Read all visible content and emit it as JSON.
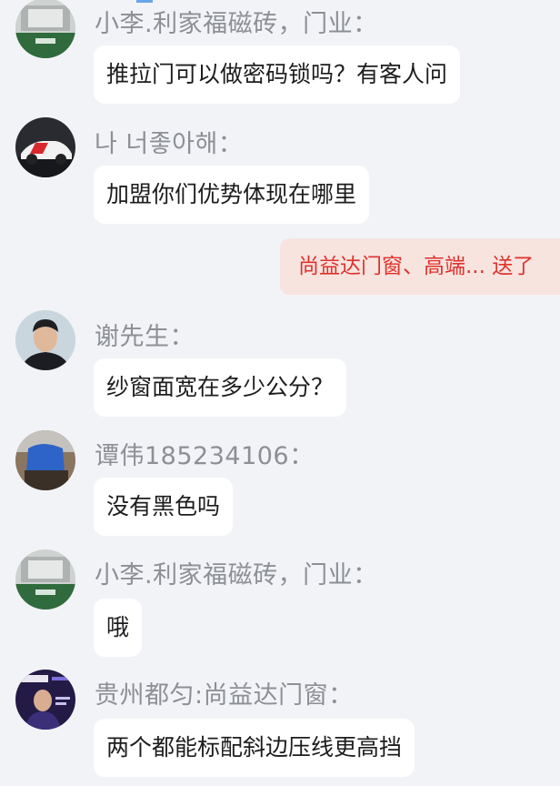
{
  "messages": [
    {
      "sender": "小李.利家福磁砖，门业：",
      "text": "推拉门可以做密码锁吗？有客人问",
      "avatar_icon": "store-logo-avatar-icon"
    },
    {
      "sender": "나 너좋아해：",
      "text": "加盟你们优势体现在哪里",
      "avatar_icon": "car-avatar-icon"
    },
    {
      "sender": "谢先生：",
      "text": "纱窗面宽在多少公分？",
      "avatar_icon": "man-photo-avatar-icon"
    },
    {
      "sender": "谭伟185234106：",
      "text": "没有黑色吗",
      "avatar_icon": "blue-jacket-avatar-icon"
    },
    {
      "sender": "小李.利家福磁砖，门业：",
      "text": "哦",
      "avatar_icon": "store-logo-avatar-icon"
    },
    {
      "sender": "贵州都匀:尚益达门窗：",
      "text": "两个都能标配斜边压线更高挡",
      "avatar_icon": "poster-avatar-icon"
    }
  ],
  "announcement": {
    "text": "尚益达门窗、高端... 送了"
  },
  "colors": {
    "background": "#f2f3f7",
    "bubble": "#ffffff",
    "sender": "#8c8f94",
    "announcement_bg": "#f7e4df",
    "announcement_text": "#e0312c"
  }
}
